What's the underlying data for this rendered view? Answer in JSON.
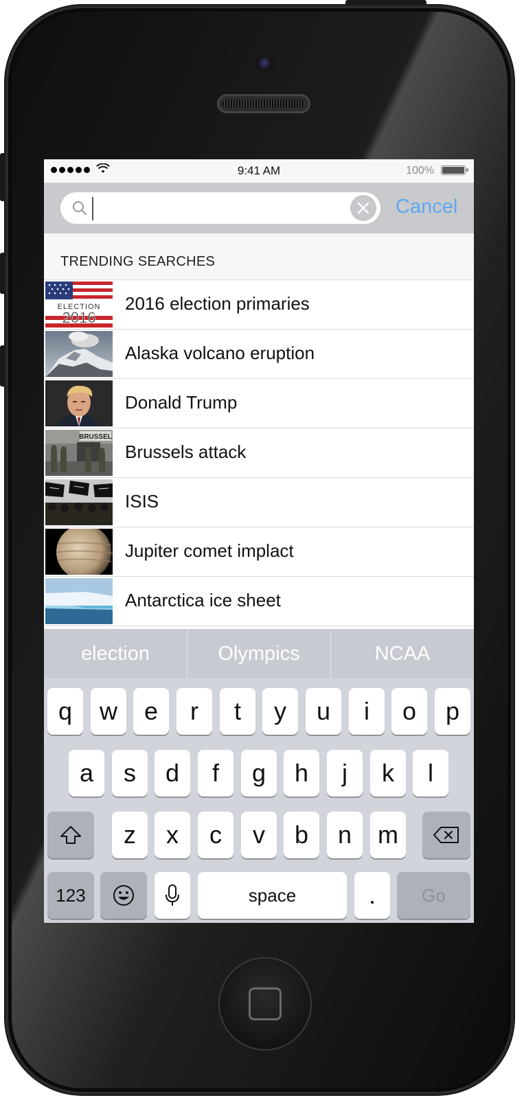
{
  "status_bar": {
    "time": "9:41 AM",
    "battery_percent": "100%"
  },
  "search": {
    "query": "",
    "cancel_label": "Cancel"
  },
  "trending": {
    "title": "TRENDING SEARCHES",
    "items": [
      {
        "label": "2016 election primaries",
        "thumb_text": "ELECTION 2016"
      },
      {
        "label": "Alaska volcano eruption"
      },
      {
        "label": "Donald Trump"
      },
      {
        "label": "Brussels attack",
        "thumb_text": "BRUSSEL"
      },
      {
        "label": "ISIS"
      },
      {
        "label": "Jupiter comet implact"
      },
      {
        "label": "Antarctica ice sheet"
      }
    ]
  },
  "suggestions": [
    "election",
    "Olympics",
    "NCAA"
  ],
  "keyboard": {
    "row1": [
      "q",
      "w",
      "e",
      "r",
      "t",
      "y",
      "u",
      "i",
      "o",
      "p"
    ],
    "row2": [
      "a",
      "s",
      "d",
      "f",
      "g",
      "h",
      "j",
      "k",
      "l"
    ],
    "row3": [
      "z",
      "x",
      "c",
      "v",
      "b",
      "n",
      "m"
    ],
    "numbers_label": "123",
    "space_label": "space",
    "period_label": ".",
    "go_label": "Go"
  },
  "colors": {
    "accent": "#5fa8f2",
    "search_bar_bg": "#c9cacd",
    "keyboard_bg": "#d1d4da"
  }
}
